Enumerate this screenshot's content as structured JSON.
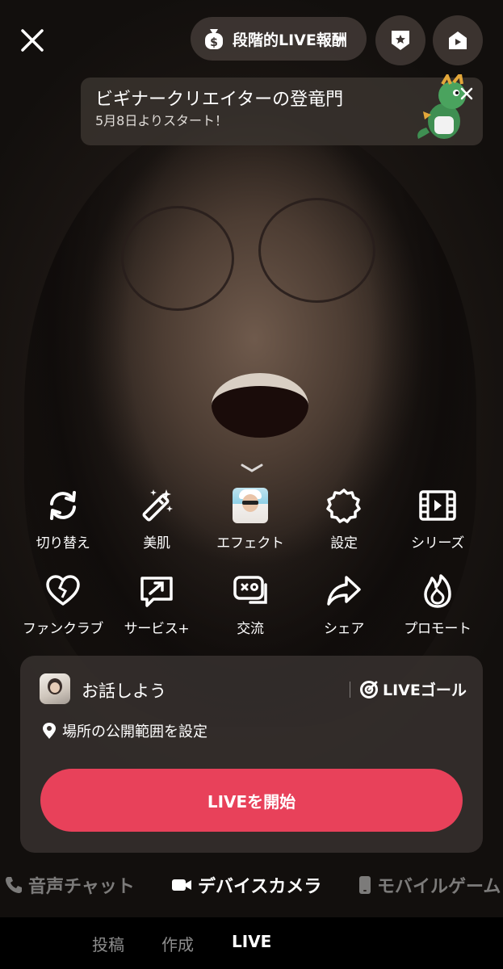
{
  "top_bar": {
    "reward_label": "段階的LIVE報酬"
  },
  "banner": {
    "title": "ビギナークリエイターの登竜門",
    "subtitle": "5月8日よりスタート！"
  },
  "tools_row1": [
    {
      "label": "切り替え",
      "icon": "flip-camera-icon"
    },
    {
      "label": "美肌",
      "icon": "beauty-wand-icon"
    },
    {
      "label": "エフェクト",
      "icon": "effect-thumbnail"
    },
    {
      "label": "設定",
      "icon": "gear-icon"
    },
    {
      "label": "シリーズ",
      "icon": "film-icon"
    }
  ],
  "tools_row2": [
    {
      "label": "ファンクラブ",
      "icon": "heart-icon"
    },
    {
      "label": "サービス+",
      "icon": "service-arrow-icon"
    },
    {
      "label": "交流",
      "icon": "game-chat-icon"
    },
    {
      "label": "シェア",
      "icon": "share-arrow-icon"
    },
    {
      "label": "プロモート",
      "icon": "flame-icon"
    }
  ],
  "panel": {
    "title": "お話しよう",
    "goal_label": "LIVEゴール",
    "location_label": "場所の公開範囲を設定",
    "start_button": "LIVEを開始"
  },
  "modes": [
    {
      "label": "音声チャット",
      "icon": "phone-icon",
      "active": false
    },
    {
      "label": "デバイスカメラ",
      "icon": "video-camera-icon",
      "active": true
    },
    {
      "label": "モバイルゲーム",
      "icon": "mobile-icon",
      "active": false
    }
  ],
  "bottom_nav": {
    "post": "投稿",
    "create": "作成",
    "live": "LIVE"
  },
  "colors": {
    "accent": "#e8415a",
    "pill_bg": "#463e3a",
    "panel_bg": "#38322f"
  }
}
